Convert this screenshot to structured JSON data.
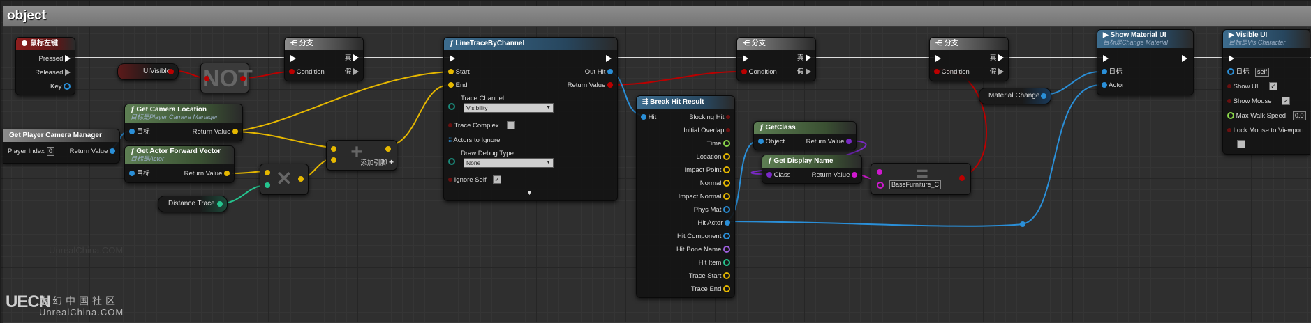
{
  "comment": {
    "title": "object"
  },
  "nodes": {
    "mouse_event": {
      "title": "鼠标左键",
      "pins": {
        "pressed": "Pressed",
        "released": "Released",
        "key": "Key"
      }
    },
    "ui_visible": {
      "label": "UIVisible"
    },
    "not_node": {
      "label": "NOT"
    },
    "branch1": {
      "title": "分支",
      "condition": "Condition",
      "true": "真",
      "false": "假"
    },
    "branch2": {
      "title": "分支",
      "condition": "Condition",
      "true": "真",
      "false": "假"
    },
    "branch3": {
      "title": "分支",
      "condition": "Condition",
      "true": "真",
      "false": "假"
    },
    "line_trace": {
      "title": "LineTraceByChannel",
      "start": "Start",
      "end": "End",
      "trace_channel_label": "Trace Channel",
      "trace_channel_value": "Visibility",
      "trace_complex": "Trace Complex",
      "actors_to_ignore": "Actors to Ignore",
      "draw_debug_label": "Draw Debug Type",
      "draw_debug_value": "None",
      "ignore_self": "Ignore Self",
      "out_hit": "Out Hit",
      "return_value": "Return Value"
    },
    "get_camera_location": {
      "title": "Get Camera Location",
      "subtitle": "目标是Player Camera Manager",
      "target": "目标",
      "return_value": "Return Value"
    },
    "get_player_camera_manager": {
      "title": "Get Player Camera Manager",
      "player_index": "Player Index",
      "player_index_value": "0",
      "return_value": "Return Value"
    },
    "get_forward_vector": {
      "title": "Get Actor Forward Vector",
      "subtitle": "目标是Actor",
      "target": "目标",
      "return_value": "Return Value"
    },
    "distance_trace": {
      "label": "Distance Trace"
    },
    "add_node": {
      "add_pin": "添加引脚"
    },
    "break_hit": {
      "title": "Break Hit Result",
      "hit": "Hit",
      "outputs": [
        "Blocking Hit",
        "Initial Overlap",
        "Time",
        "Location",
        "Impact Point",
        "Normal",
        "Impact Normal",
        "Phys Mat",
        "Hit Actor",
        "Hit Component",
        "Hit Bone Name",
        "Hit Item",
        "Trace Start",
        "Trace End"
      ]
    },
    "get_class": {
      "title": "GetClass",
      "object": "Object",
      "return_value": "Return Value"
    },
    "get_display_name": {
      "title": "Get Display Name",
      "class": "Class",
      "return_value": "Return Value"
    },
    "equal_node": {
      "value": "BaseFurniture_C"
    },
    "material_change": {
      "label": "Material Change"
    },
    "show_material_ui": {
      "title": "Show Material UI",
      "subtitle": "目标是Change Material",
      "target": "目标",
      "actor": "Actor"
    },
    "visible_ui": {
      "title": "Visible UI",
      "subtitle": "目标是Vis Character",
      "target": "目标",
      "target_value": "self",
      "show_ui": "Show UI",
      "show_mouse": "Show Mouse",
      "max_walk_speed": "Max Walk Speed",
      "max_walk_speed_value": "0.0",
      "lock_mouse": "Lock Mouse to Viewport"
    }
  },
  "watermark": {
    "logo": "UECN",
    "cn_text": "虚幻中国社区",
    "en_text": "UnrealChina.COM",
    "faint_text": "UnrealChina.COM"
  }
}
